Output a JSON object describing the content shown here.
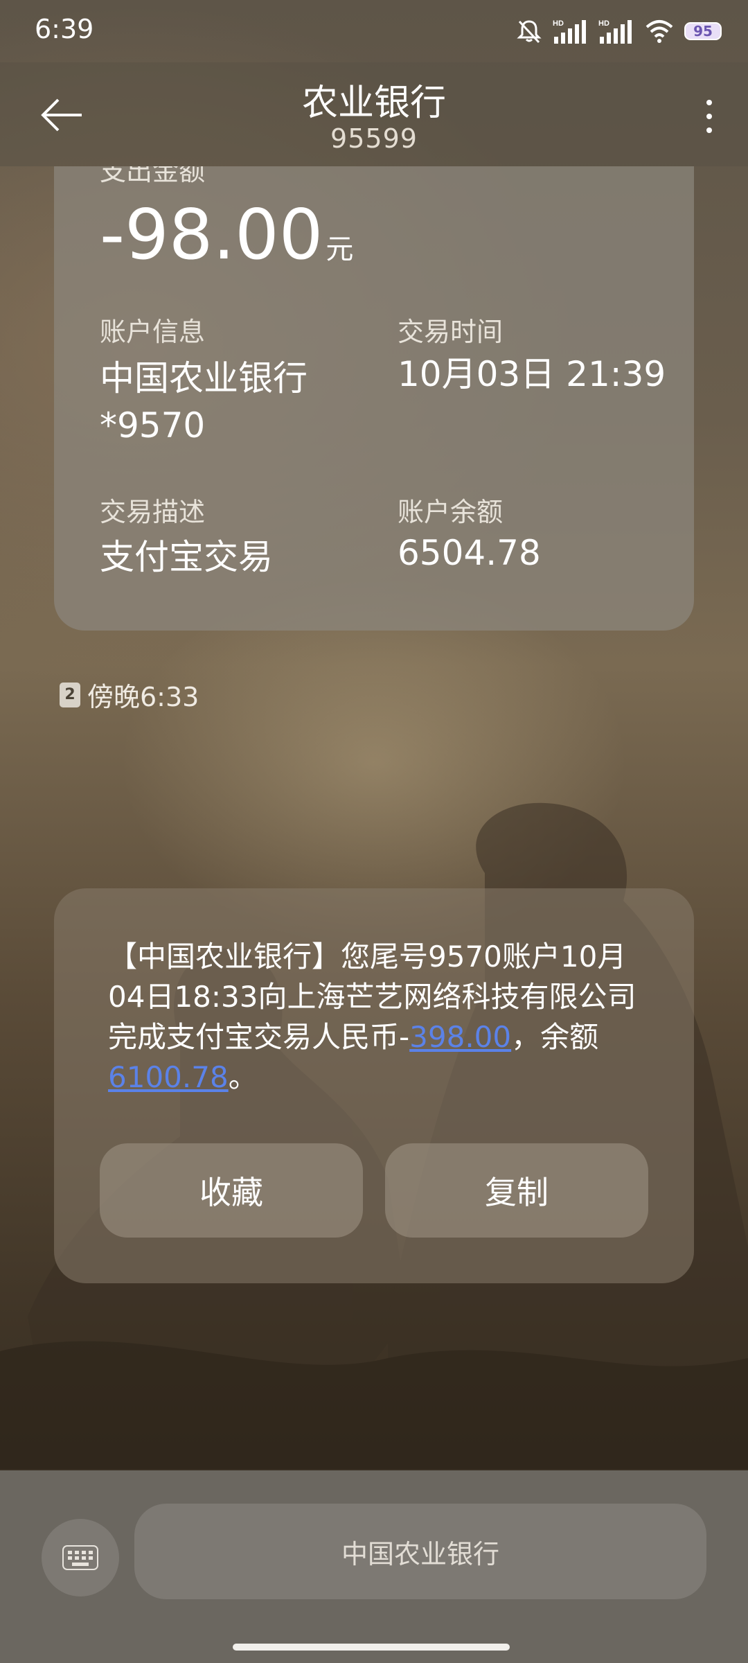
{
  "status_bar": {
    "time": "6:39",
    "battery": "95",
    "icons": [
      "mute-icon",
      "hd-signal-icon",
      "hd-signal-icon",
      "wifi-icon",
      "battery-icon"
    ]
  },
  "header": {
    "title": "农业银行",
    "subtitle": "95599",
    "back_icon": "back-arrow-icon",
    "more_icon": "more-vertical-icon"
  },
  "transaction_card": {
    "amount_label": "支出金额",
    "amount": "-98.00",
    "amount_unit": "元",
    "account_info_label": "账户信息",
    "account_bank": "中国农业银行",
    "account_number": "*9570",
    "transaction_time_label": "交易时间",
    "transaction_time": "10月03日 21:39",
    "description_label": "交易描述",
    "description": "支付宝交易",
    "balance_label": "账户余额",
    "balance": "6504.78"
  },
  "message_meta": {
    "sim": "2",
    "time": "傍晚6:33"
  },
  "sms_card": {
    "text_part1": "【中国农业银行】您尾号9570账户10月04日18:33向上海芒艺网络科技有限公司完成支付宝交易人民币-",
    "amount_link": "398.00",
    "text_part2": "，余额",
    "balance_link": "6100.78",
    "text_part3": "。",
    "favorite_label": "收藏",
    "copy_label": "复制"
  },
  "bottom_bar": {
    "keyboard_icon": "keyboard-icon",
    "input_label": "中国农业银行"
  },
  "colors": {
    "link": "#5b82e8"
  }
}
